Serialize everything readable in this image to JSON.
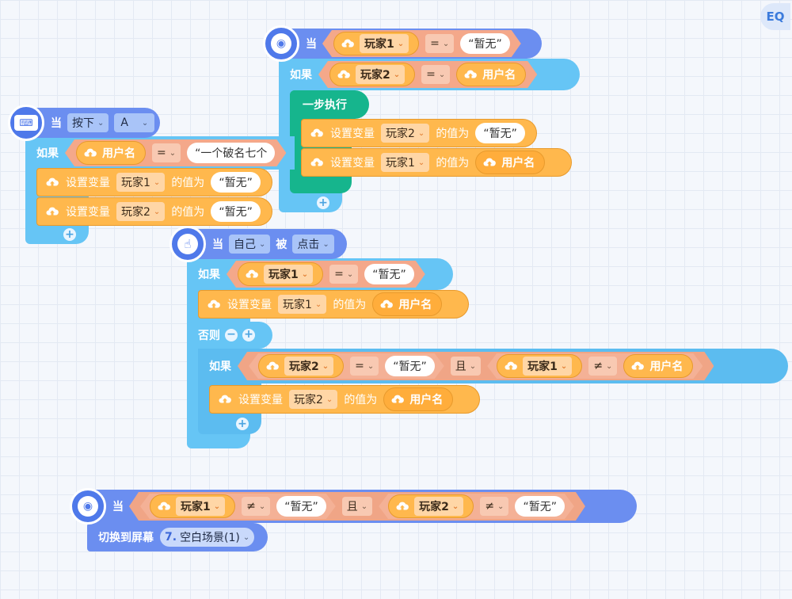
{
  "zoom_label": "EQ",
  "kw": {
    "when": "当",
    "if": "如果",
    "else": "否则",
    "and": "且",
    "eq": "=",
    "neq": "≠",
    "set_var": "设置变量",
    "value_is": "的值为",
    "clicked": "被",
    "step_exec": "一步执行",
    "switch_screen": "切换到屏幕",
    "plus": "+",
    "minus": "−"
  },
  "block1": {
    "var": "玩家1",
    "value": "“暂无”",
    "if_var": "玩家2",
    "if_rhs": "用户名",
    "set1_var": "玩家2",
    "set1_value": "“暂无”",
    "set2_var": "玩家1",
    "set2_value": "用户名"
  },
  "block2": {
    "action": "按下",
    "key": "A",
    "if_lhs": "用户名",
    "if_rhs": "“一个破名七个",
    "set1_var": "玩家1",
    "set1_value": "“暂无”",
    "set2_var": "玩家2",
    "set2_value": "“暂无”"
  },
  "block3": {
    "target": "自己",
    "event": "点击",
    "if_var": "玩家1",
    "if_value": "“暂无”",
    "set1_var": "玩家1",
    "set1_value": "用户名",
    "elif_var1": "玩家2",
    "elif_value1": "“暂无”",
    "elif_var2": "玩家1",
    "elif_rhs2": "用户名",
    "set2_var": "玩家2",
    "set2_value": "用户名"
  },
  "block4": {
    "var1": "玩家1",
    "value1": "“暂无”",
    "var2": "玩家2",
    "value2": "“暂无”",
    "screen_num": "7.",
    "screen_name": "空白场景(1)"
  }
}
